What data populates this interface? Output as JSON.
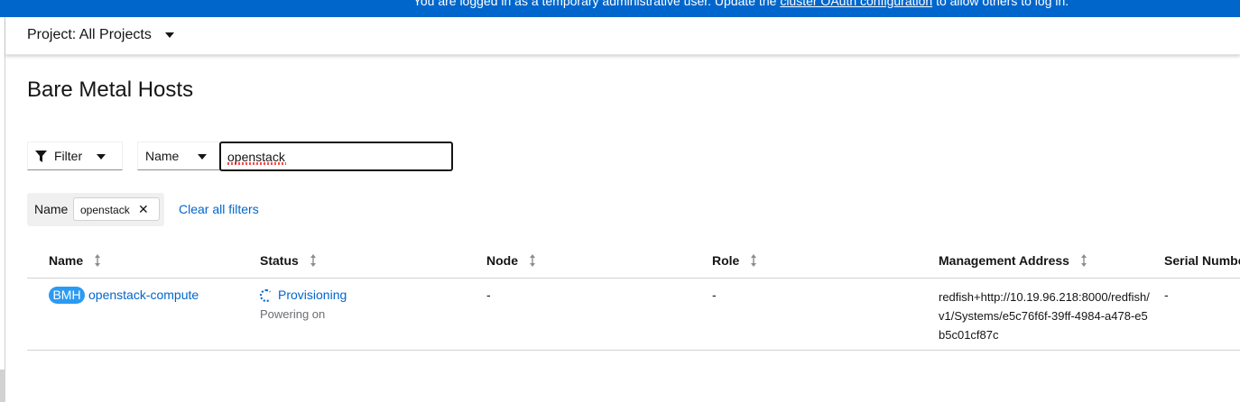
{
  "banner": {
    "prefix": "You are logged in as a temporary administrative user. Update the ",
    "link": "cluster OAuth configuration",
    "suffix": " to allow others to log in."
  },
  "project": {
    "label": "Project: All Projects"
  },
  "page": {
    "title": "Bare Metal Hosts"
  },
  "toolbar": {
    "filter_label": "Filter",
    "attribute_label": "Name",
    "search_value": "openstack"
  },
  "chips": {
    "group_label": "Name",
    "chip_text": "openstack",
    "clear_label": "Clear all filters"
  },
  "table": {
    "headers": [
      "Name",
      "Status",
      "Node",
      "Role",
      "Management Address",
      "Serial Number"
    ],
    "rows": [
      {
        "badge": "BMH",
        "name": "openstack-compute",
        "status": "Provisioning",
        "status_detail": "Powering on",
        "node": "-",
        "role": "-",
        "management_address": "redfish+http://10.19.96.218:8000/redfish/v1/Systems/e5c76f6f-39ff-4984-a478-e5b5c01cf87c",
        "serial_number": "-"
      }
    ]
  },
  "colors": {
    "banner": "#0066cc",
    "link": "#0066cc",
    "badge": "#2b9af3"
  }
}
